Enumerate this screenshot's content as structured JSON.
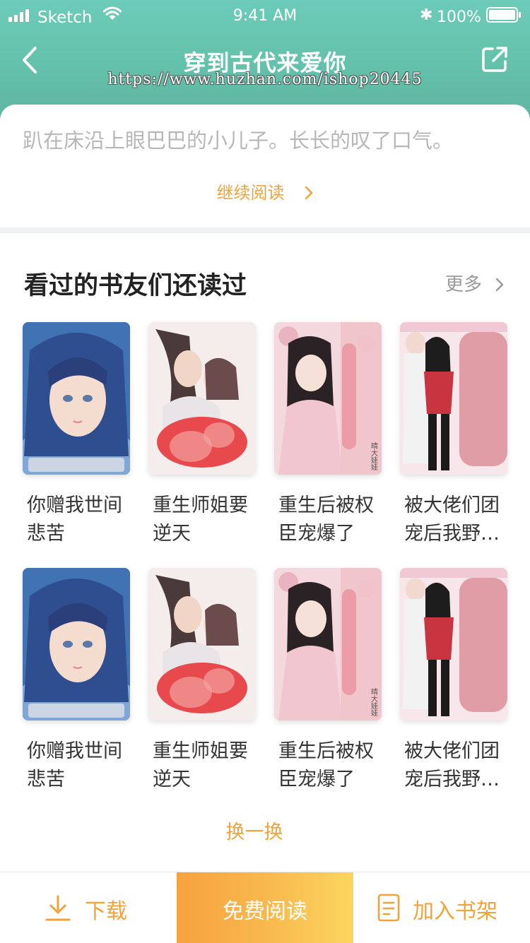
{
  "status_bar": {
    "carrier": "Sketch",
    "time": "9:41 AM",
    "battery": "100%"
  },
  "nav": {
    "title": "穿到古代来爱你",
    "watermark": "https://www.huzhan.com/ishop20445"
  },
  "excerpt": {
    "text": "趴在床沿上眼巴巴的小儿子。长长的叹了口气。",
    "continue_label": "继续阅读"
  },
  "recommend": {
    "title": "看过的书友们还读过",
    "more_label": "更多",
    "books": [
      {
        "title": "你赠我世间悲苦",
        "cover": "blue-girl"
      },
      {
        "title": "重生师姐要逆天",
        "cover": "couple-red"
      },
      {
        "title": "重生后被权臣宠爆了",
        "cover": "pink-ancient"
      },
      {
        "title": "被大佬们团宠后我野…",
        "cover": "modern-couple"
      },
      {
        "title": "你赠我世间悲苦",
        "cover": "blue-girl"
      },
      {
        "title": "重生师姐要逆天",
        "cover": "couple-red"
      },
      {
        "title": "重生后被权臣宠爆了",
        "cover": "pink-ancient"
      },
      {
        "title": "被大佬们团宠后我野…",
        "cover": "modern-couple"
      }
    ],
    "refresh_label": "换一换"
  },
  "bottom_bar": {
    "download_label": "下载",
    "read_label": "免费阅读",
    "shelf_label": "加入书架"
  },
  "colors": {
    "header": "#63bfa9",
    "accent": "#f2a33a",
    "read_gradient_start": "#f7a23f",
    "read_gradient_end": "#fcd55f"
  }
}
